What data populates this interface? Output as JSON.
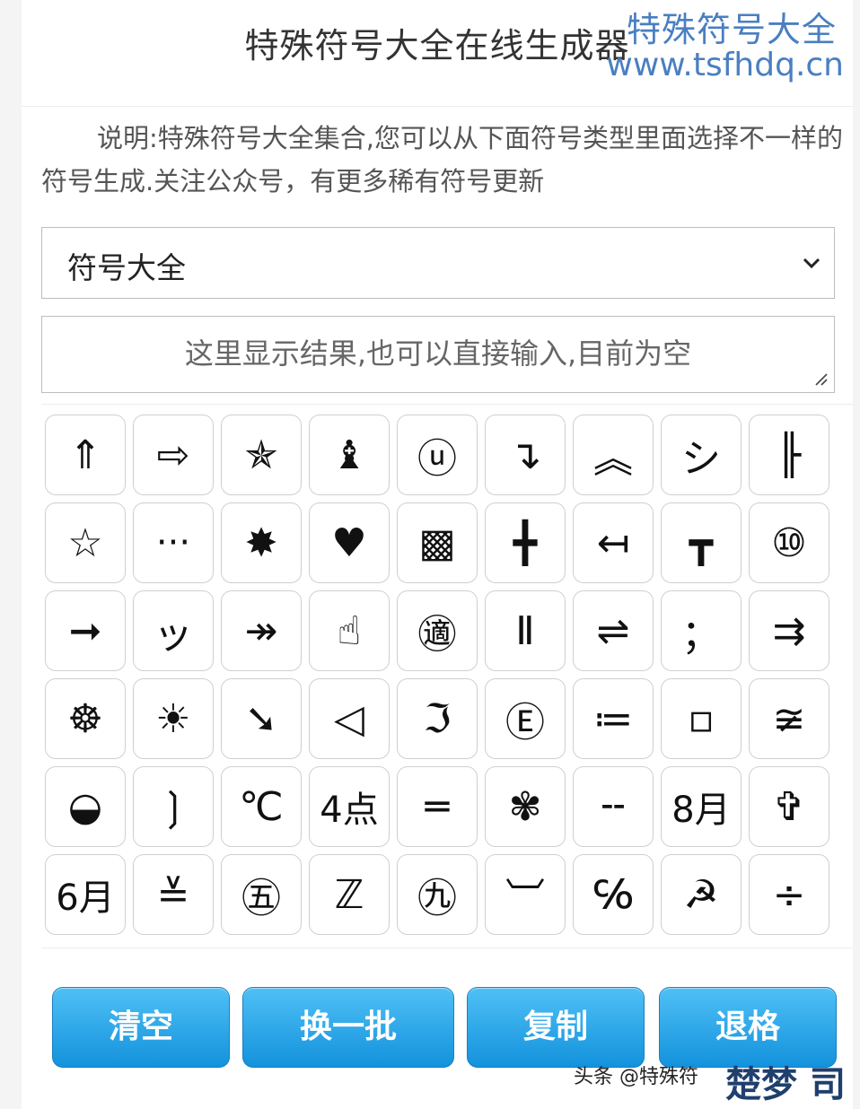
{
  "header": {
    "title": "特殊符号大全在线生成器",
    "watermark_name": "特殊符号大全",
    "watermark_url": "www.tsfhdq.cn"
  },
  "description": "说明:特殊符号大全集合,您可以从下面符号类型里面选择不一样的符号生成.关注公众号，有更多稀有符号更新",
  "type_select": {
    "value": "符号大全"
  },
  "result_box": {
    "placeholder": "这里显示结果,也可以直接输入,目前为空"
  },
  "symbols": [
    "⇑",
    "⇨",
    "✯",
    "♝",
    "ⓤ",
    "↴",
    "︽",
    "シ",
    "╟",
    "☆",
    "···",
    "✸",
    "♥",
    "▩",
    "╋",
    "↤",
    "┳",
    "⑩",
    "➞",
    "ッ",
    "↠",
    "☝",
    "㊜",
    "Ⅱ",
    "⇌",
    "；",
    "⇉",
    "☸",
    "☀",
    "➘",
    "◁",
    "ℑ",
    "Ⓔ",
    "≔",
    "▫",
    "≆",
    "◒",
    "❳",
    "℃",
    "4点",
    "═",
    "✾",
    "╌",
    "8月",
    "✞",
    "6月",
    "≚",
    "㊄",
    "ℤ",
    "㊈",
    "︺",
    "℅",
    "☭",
    "÷"
  ],
  "buttons": {
    "clear": "清空",
    "refresh": "换一批",
    "copy": "复制",
    "backspace": "退格"
  },
  "footer": {
    "credit": "头条 @特殊符",
    "logo": "楚梦 司"
  }
}
